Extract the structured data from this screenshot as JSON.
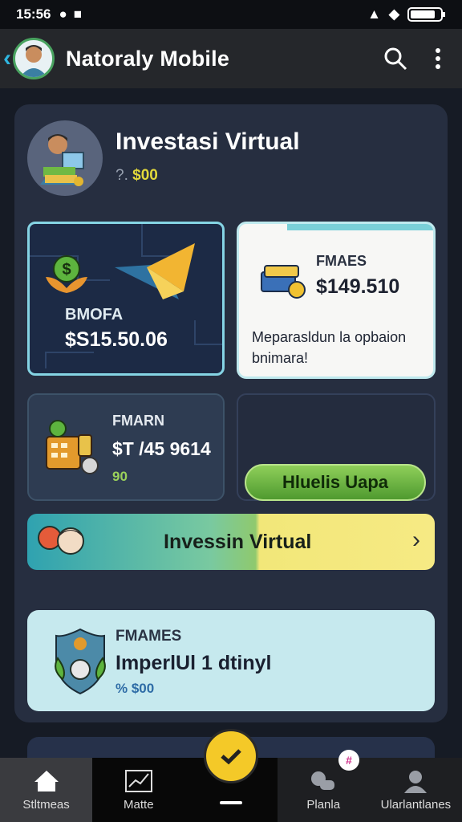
{
  "status_bar": {
    "time": "15:56",
    "battery_icon": "battery-icon",
    "signal_icon": "signal-icon",
    "wifi_icon": "wifi-icon"
  },
  "app_bar": {
    "title": "Natoraly Mobile",
    "icons": [
      "back-icon",
      "search-icon",
      "more-vert-icon"
    ]
  },
  "header": {
    "title": "Investasi Virtual",
    "sub_prefix": "?.",
    "sub_value": "$00"
  },
  "cards": {
    "card1": {
      "label": "BMOFA",
      "value": "$S15.50.06"
    },
    "card2": {
      "label": "FMAES",
      "value": "$149.510",
      "description": "Meparasldun la opbaion bnimara!"
    },
    "card3": {
      "label": "FMARN",
      "value": "$T /45 9614",
      "small": "90"
    },
    "card4": {
      "button": "Hluelis Uapa"
    }
  },
  "banner": {
    "label": "Invessin Virtual"
  },
  "card5": {
    "label": "FMAMES",
    "value": "ImperlUl 1 dtinyl",
    "small": "% $00"
  },
  "bottom_nav": {
    "items": [
      {
        "label": "Stltmeas",
        "icon": "home-icon"
      },
      {
        "label": "Matte",
        "icon": "chart-icon"
      },
      {
        "label": "",
        "icon": "check-icon"
      },
      {
        "label": "Planla",
        "icon": "link-icon"
      },
      {
        "label": "Ularlantlanes",
        "icon": "profile-icon"
      }
    ],
    "badge": "#"
  },
  "colors": {
    "accent": "#f4c928",
    "panel": "#262e40",
    "green": "#6fb944",
    "cyan": "#85d4e4"
  }
}
